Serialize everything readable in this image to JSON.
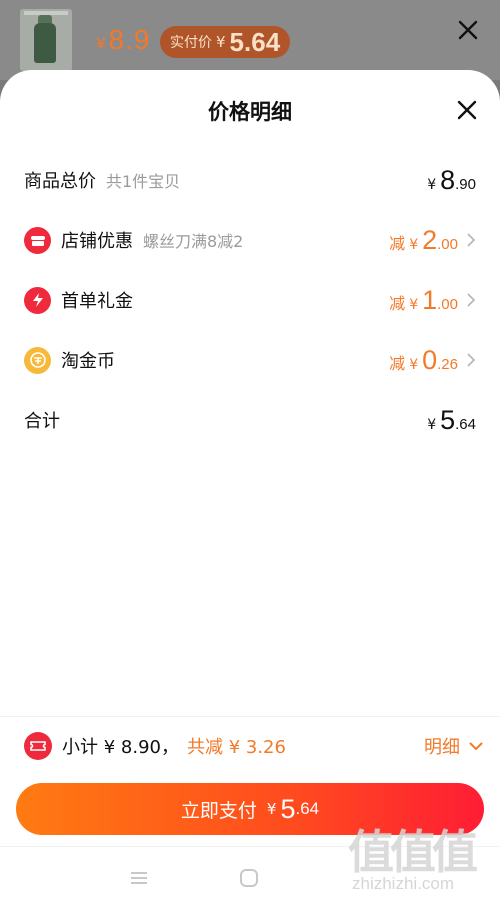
{
  "top_bar": {
    "price_yen": "¥",
    "price_value": "8.9",
    "badge_label": "实付价",
    "badge_yen": "¥",
    "badge_value": "5.64"
  },
  "sheet": {
    "title": "价格明细",
    "rows": [
      {
        "label": "商品总价",
        "sub": "共1件宝贝",
        "yen": "¥",
        "int": "8",
        "dec": ".90"
      },
      {
        "label": "店铺优惠",
        "sub": "螺丝刀满8减2",
        "reduce": "减",
        "yen": "¥",
        "int": "2",
        "dec": ".00",
        "icon": "store-icon"
      },
      {
        "label": "首单礼金",
        "reduce": "减",
        "yen": "¥",
        "int": "1",
        "dec": ".00",
        "icon": "lightning-icon"
      },
      {
        "label": "淘金币",
        "reduce": "减",
        "yen": "¥",
        "int": "0",
        "dec": ".26",
        "icon": "coin-icon"
      },
      {
        "label": "合计",
        "yen": "¥",
        "int": "5",
        "dec": ".64"
      }
    ]
  },
  "summary": {
    "subtotal": "小计 ¥ 8.90，",
    "reduction": "共减 ¥ 3.26",
    "detail": "明细"
  },
  "pay_button": {
    "label": "立即支付",
    "yen": "¥",
    "int": "5",
    "dec": ".64"
  },
  "watermark": {
    "logo": "值值值",
    "site": "zhizhizhi.com"
  },
  "colors": {
    "accent_orange": "#f27a2a",
    "icon_red": "#ee2a3c",
    "icon_gold": "#f7b93a"
  }
}
